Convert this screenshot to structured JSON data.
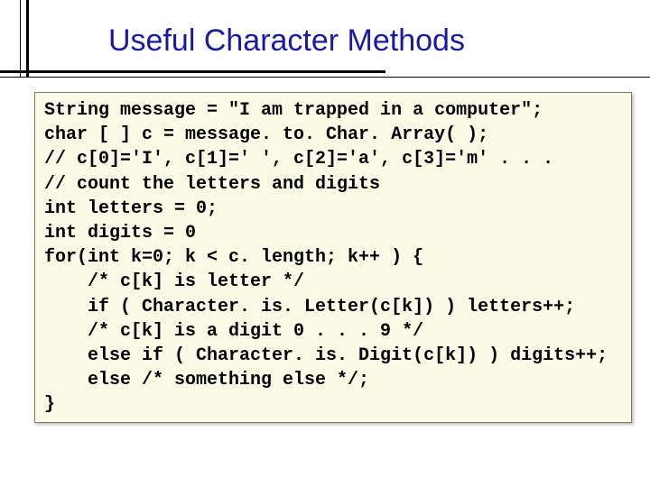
{
  "title": "Useful Character Methods",
  "code": {
    "l1": "String message = \"I am trapped in a computer\";",
    "l2": "char [ ] c = message. to. Char. Array( );",
    "l3": "// c[0]='I', c[1]=' ', c[2]='a', c[3]='m' . . .",
    "l4": "// count the letters and digits",
    "l5": "int letters = 0;",
    "l6": "int digits = 0",
    "l7": "for(int k=0; k < c. length; k++ ) {",
    "l8": "    /* c[k] is letter */",
    "l9": "    if ( Character. is. Letter(c[k]) ) letters++;",
    "l10": "    /* c[k] is a digit 0 . . . 9 */",
    "l11": "    else if ( Character. is. Digit(c[k]) ) digits++;",
    "l12": "    else /* something else */;",
    "l13": "}"
  }
}
